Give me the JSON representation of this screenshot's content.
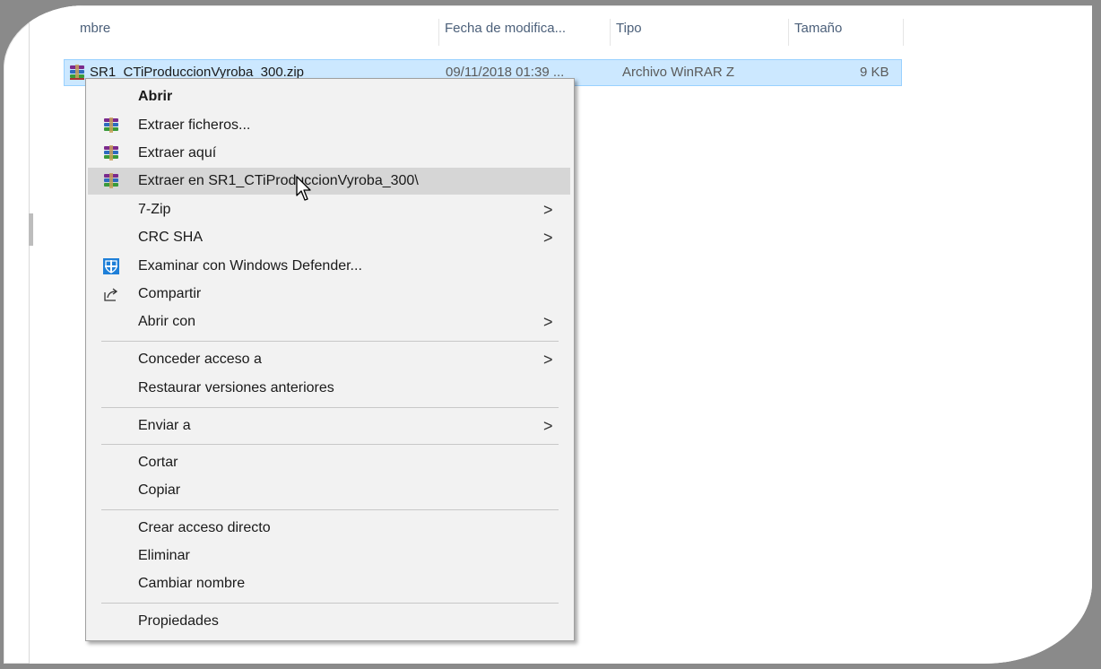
{
  "colors": {
    "selection": "#cce8ff",
    "selection_border": "#99d1ff",
    "menu_bg": "#f2f2f2",
    "menu_highlight": "#d6d6d6",
    "header_text": "#4c607a"
  },
  "header": {
    "col_name": "mbre",
    "col_date": "Fecha de modifica...",
    "col_type": "Tipo",
    "col_size": "Tamaño"
  },
  "file": {
    "icon": "winrar-archive-icon",
    "name": "SR1_CTiProduccionVyroba_300.zip",
    "date": "09/11/2018 01:39 ...",
    "type": "Archivo WinRAR Z",
    "size": "9 KB"
  },
  "menu": {
    "open": "Abrir",
    "extract_files": "Extraer ficheros...",
    "extract_here": "Extraer aquí",
    "extract_to": "Extraer en SR1_CTiProduccionVyroba_300\\",
    "seven_zip": "7-Zip",
    "crc_sha": "CRC SHA",
    "defender": "Examinar con Windows Defender...",
    "share": "Compartir",
    "open_with": "Abrir con",
    "give_access": "Conceder acceso a",
    "restore_versions": "Restaurar versiones anteriores",
    "send_to": "Enviar a",
    "cut": "Cortar",
    "copy": "Copiar",
    "create_shortcut": "Crear acceso directo",
    "delete": "Eliminar",
    "rename": "Cambiar nombre",
    "properties": "Propiedades",
    "submenu_arrow": ">"
  }
}
